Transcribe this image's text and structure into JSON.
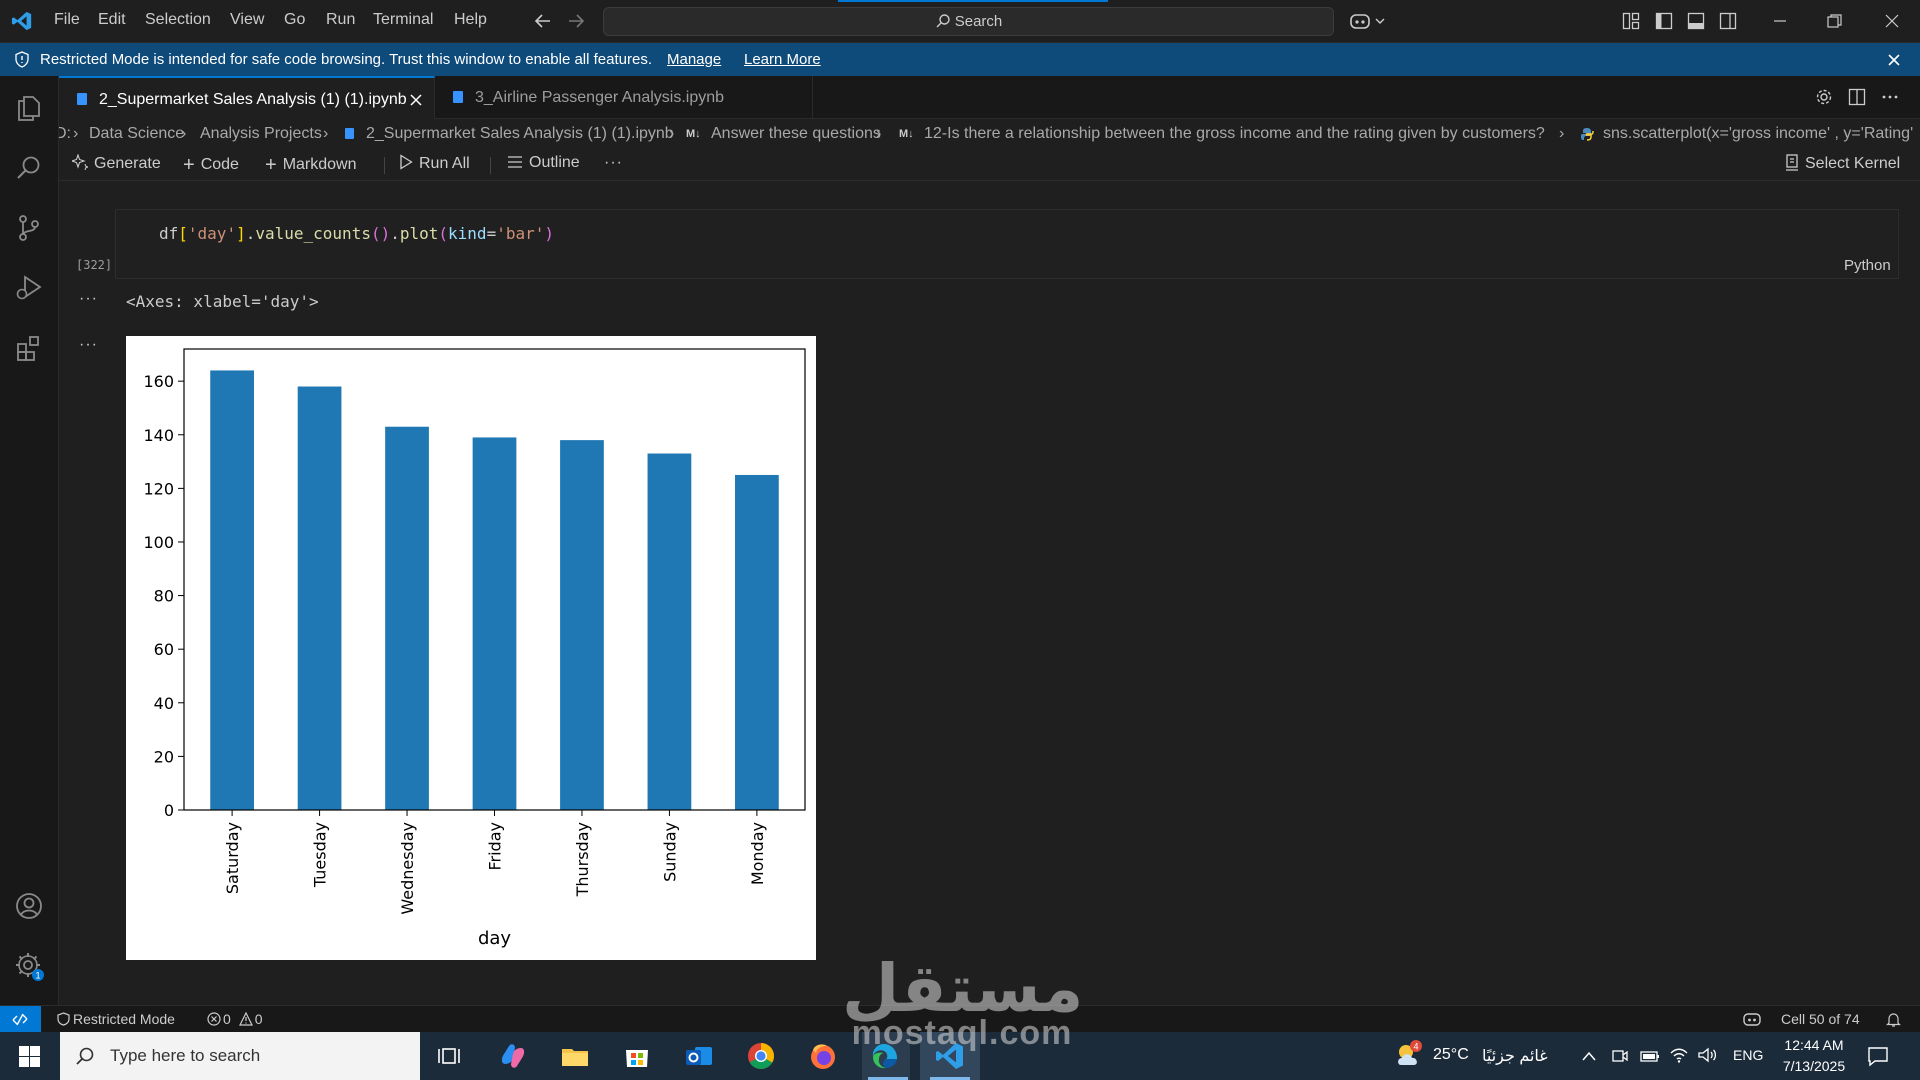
{
  "menu": [
    "File",
    "Edit",
    "Selection",
    "View",
    "Go",
    "Run",
    "Terminal",
    "Help"
  ],
  "search": {
    "label": "Search"
  },
  "banner": {
    "message": "Restricted Mode is intended for safe code browsing. Trust this window to enable all features.",
    "manage": "Manage",
    "learn_more": "Learn More"
  },
  "tabs": [
    {
      "label": "2_Supermarket Sales Analysis (1) (1).ipynb",
      "active": true
    },
    {
      "label": "3_Airline Passenger Analysis.ipynb",
      "active": false
    }
  ],
  "breadcrumb": {
    "root": "D:",
    "items": [
      "Data Science",
      "Analysis Projects",
      "2_Supermarket Sales Analysis (1) (1).ipynb",
      "Answer these questions",
      "12-Is there a relationship between the gross income and the rating given by customers?",
      "sns.scatterplot(x='gross income' , y='Rating'"
    ]
  },
  "toolbar": {
    "generate": "Generate",
    "code": "Code",
    "markdown": "Markdown",
    "run_all": "Run All",
    "outline": "Outline",
    "more": "···",
    "select_kernel": "Select Kernel"
  },
  "cell": {
    "execution_count": "[322]",
    "language": "Python",
    "code_parts": [
      "df",
      "[",
      "'day'",
      "]",
      ".",
      "value_counts",
      "()",
      ".",
      "plot",
      "(",
      "kind",
      "=",
      "'bar'",
      ")"
    ],
    "output_text": "<Axes: xlabel='day'>",
    "ellipsis": "···"
  },
  "chart_data": {
    "type": "bar",
    "categories": [
      "Saturday",
      "Tuesday",
      "Wednesday",
      "Friday",
      "Thursday",
      "Sunday",
      "Monday"
    ],
    "values": [
      164,
      158,
      143,
      139,
      138,
      133,
      125
    ],
    "xlabel": "day",
    "ylabel": "",
    "ylim": [
      0,
      172
    ],
    "yticks": [
      0,
      20,
      40,
      60,
      80,
      100,
      120,
      140,
      160
    ],
    "bar_color": "#1f77b4"
  },
  "status": {
    "restricted": "Restricted Mode",
    "errors": "0",
    "warnings": "0",
    "cell_position": "Cell 50 of 74"
  },
  "taskbar": {
    "search_placeholder": "Type here to search",
    "weather_temp": "25°C",
    "weather_desc": "غائم جزئيًا",
    "weather_badge": "4",
    "language": "ENG",
    "time": "12:44 AM",
    "date": "7/13/2025"
  },
  "watermark": {
    "arabic": "مستقل",
    "latin": "mostaql.com"
  },
  "colors": {
    "accent": "#0078d4",
    "banner": "#0e4a7a",
    "bar": "#1f77b4"
  }
}
